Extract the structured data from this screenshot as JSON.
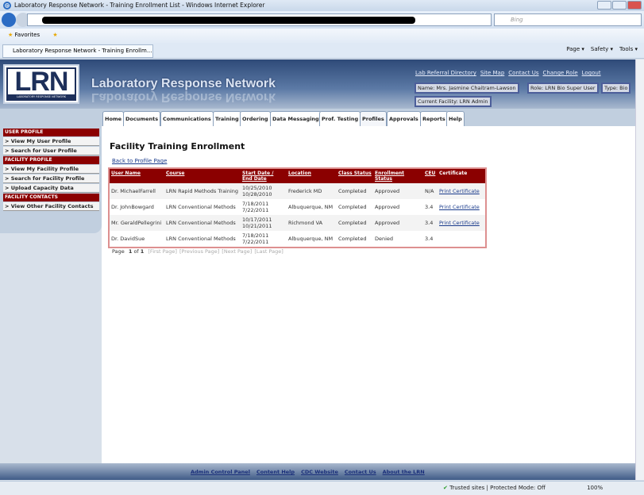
{
  "browser": {
    "window_title": "Laboratory Response Network - Training Enrollment List - Windows Internet Explorer",
    "search_placeholder": "Bing",
    "favorites": "Favorites",
    "tab_title": "Laboratory Response Network - Training Enrollm...",
    "cmd": [
      "Page ▾",
      "Safety ▾",
      "Tools ▾"
    ],
    "status": "Trusted sites | Protected Mode: Off",
    "zoom": "100%"
  },
  "header": {
    "logo_text": "LRN",
    "logo_sub": "LABORATORY RESPONSE NETWORK",
    "site_name": "Laboratory Response Network",
    "links": [
      "Lab Referral Directory",
      "Site Map",
      "Contact Us",
      "Change Role",
      "Logout"
    ],
    "name": "Name: Mrs. Jasmine Chaitram-Lawson",
    "role": "Role: LRN Bio Super User",
    "type": "Type: Bio",
    "facility": "Current Facility: LRN Admin"
  },
  "nav": [
    "Home",
    "Documents",
    "Communications",
    "Training",
    "Ordering",
    "Data Messaging",
    "Prof. Testing",
    "Profiles",
    "Approvals",
    "Reports",
    "Help"
  ],
  "sidebar": [
    {
      "header": "USER PROFILE",
      "items": [
        "> View My User Profile",
        "> Search for User Profile"
      ]
    },
    {
      "header": "FACILITY PROFILE",
      "items": [
        "> View My Facility Profile",
        "> Search for Facility Profile",
        "> Upload Capacity Data"
      ]
    },
    {
      "header": "FACILITY CONTACTS",
      "items": [
        "> View Other Facility Contacts"
      ]
    }
  ],
  "main": {
    "title": "Facility Training Enrollment",
    "back_link": "Back to Profile Page",
    "columns": [
      "User Name",
      "Course",
      "Start Date / End Date",
      "Location",
      "Class Status",
      "Enrollment Status",
      "CEU",
      "Certificate"
    ],
    "rows": [
      [
        "Dr. MichaelFarrell",
        "LRN Rapid Methods Training",
        "10/25/2010 10/28/2010",
        "Frederick MD",
        "Completed",
        "Approved",
        "N/A",
        "Print Certificate"
      ],
      [
        "Dr. JohnBowgard",
        "LRN Conventional Methods",
        "7/18/2011 7/22/2011",
        "Albuquerque, NM",
        "Completed",
        "Approved",
        "3.4",
        "Print Certificate"
      ],
      [
        "Mr. GeraldPellegrini",
        "LRN Conventional Methods",
        "10/17/2011 10/21/2011",
        "Richmond VA",
        "Completed",
        "Approved",
        "3.4",
        "Print Certificate"
      ],
      [
        "Dr. DavidSue",
        "LRN Conventional Methods",
        "7/18/2011 7/22/2011",
        "Albuquerque, NM",
        "Completed",
        "Denied",
        "3.4",
        ""
      ]
    ],
    "pager": {
      "page_label": "Page",
      "current": "1",
      "of": "of",
      "total": "1",
      "buttons": [
        "[First Page]",
        "[Previous Page]",
        "[Next Page]",
        "[Last Page]"
      ]
    }
  },
  "footer": [
    "Admin Control Panel",
    "Content Help",
    "CDC Website",
    "Contact Us",
    "About the LRN"
  ]
}
